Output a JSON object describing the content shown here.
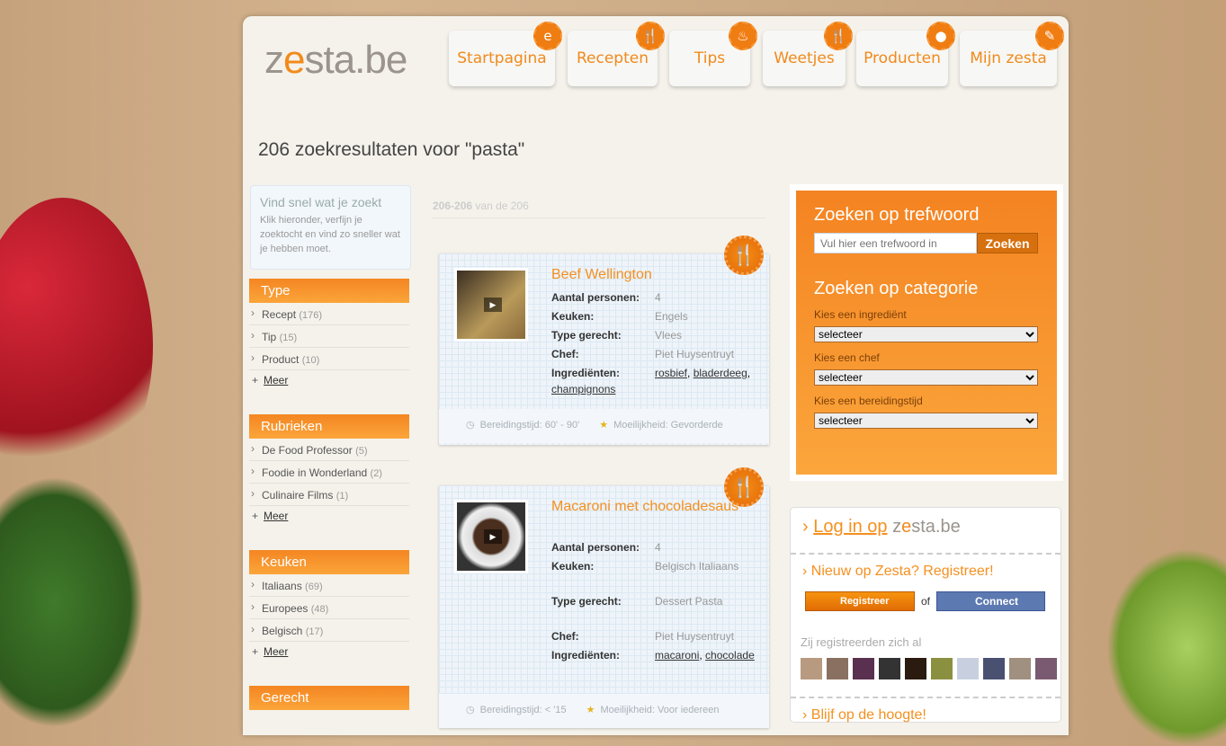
{
  "logo": {
    "text_a": "z",
    "text_b": "e",
    "text_c": "sta.be"
  },
  "nav": [
    {
      "label": "Startpagina",
      "icon": "e-logo-icon"
    },
    {
      "label": "Recepten",
      "icon": "fork-knife-icon"
    },
    {
      "label": "Tips",
      "icon": "pot-icon"
    },
    {
      "label": "Weetjes",
      "icon": "utensils-icon"
    },
    {
      "label": "Producten",
      "icon": "product-icon"
    },
    {
      "label": "Mijn zesta",
      "icon": "book-icon"
    }
  ],
  "page_title": "206 zoekresultaten voor \"pasta\"",
  "tip": {
    "title": "Vind snel wat je zoekt",
    "text": "Klik hieronder, verfijn je zoektocht en vind zo sneller wat je hebben moet."
  },
  "filters": [
    {
      "title": "Type",
      "items": [
        {
          "label": "Recept",
          "count": "(176)"
        },
        {
          "label": "Tip",
          "count": "(15)"
        },
        {
          "label": "Product",
          "count": "(10)"
        }
      ],
      "more": "Meer"
    },
    {
      "title": "Rubrieken",
      "items": [
        {
          "label": "De Food Professor",
          "count": "(5)"
        },
        {
          "label": "Foodie in Wonderland",
          "count": "(2)"
        },
        {
          "label": "Culinaire Films",
          "count": "(1)"
        }
      ],
      "more": "Meer"
    },
    {
      "title": "Keuken",
      "items": [
        {
          "label": "Italiaans",
          "count": "(69)"
        },
        {
          "label": "Europees",
          "count": "(48)"
        },
        {
          "label": "Belgisch",
          "count": "(17)"
        }
      ],
      "more": "Meer"
    },
    {
      "title": "Gerecht"
    }
  ],
  "results_count": {
    "range": "206-206",
    "suffix": "van de 206"
  },
  "labels": {
    "persons": "Aantal personen:",
    "cuisine": "Keuken:",
    "type": "Type gerecht:",
    "chef": "Chef:",
    "ingredients": "Ingrediënten:"
  },
  "results": [
    {
      "title": "Beef Wellington",
      "persons": "4",
      "cuisine": "Engels",
      "type": "Vlees",
      "chef": "Piet Huysentruyt",
      "ingredients": [
        "rosbief",
        "bladerdeeg",
        "champignons"
      ],
      "time": "Bereidingstijd: 60' - 90'",
      "difficulty": "Moeilijkheid: Gevorderde"
    },
    {
      "title": "Macaroni met chocoladesaus",
      "persons": "4",
      "cuisine": "Belgisch Italiaans",
      "type": "Dessert Pasta",
      "chef": "Piet Huysentruyt",
      "ingredients": [
        "macaroni",
        "chocolade"
      ],
      "time": "Bereidingstijd: < '15",
      "difficulty": "Moeilijkheid: Voor iedereen"
    }
  ],
  "search": {
    "keyword_title": "Zoeken op trefwoord",
    "placeholder": "Vul hier een trefwoord in",
    "button": "Zoeken",
    "category_title": "Zoeken op categorie",
    "selects": [
      {
        "label": "Kies een ingrediënt",
        "value": "selecteer"
      },
      {
        "label": "Kies een chef",
        "value": "selecteer"
      },
      {
        "label": "Kies een bereidingstijd",
        "value": "selecteer"
      }
    ]
  },
  "login": {
    "link": "Log in op",
    "new": "Nieuw op Zesta? Registreer!",
    "register": "Registreer",
    "or": "of",
    "connect": "Connect",
    "registered": "Zij registreerden zich al",
    "stay": "Blijf op de hoogte!"
  },
  "colors": {
    "accent": "#f5901f",
    "fb": "#5d79b1"
  }
}
